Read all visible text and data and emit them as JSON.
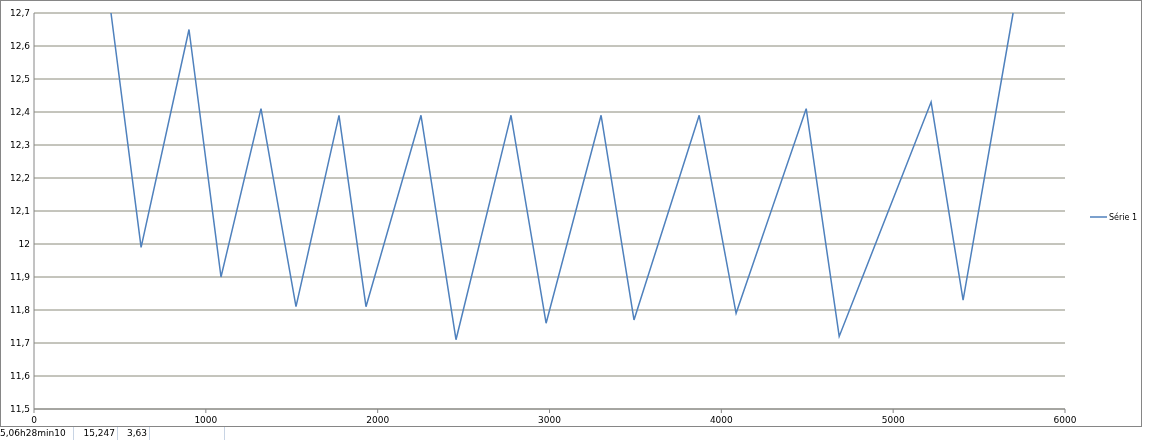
{
  "chart": {
    "chart_data": {
      "type": "line",
      "x": [
        448,
        623,
        902,
        1088,
        1321,
        1525,
        1775,
        1932,
        2252,
        2456,
        2776,
        2980,
        3300,
        3492,
        3871,
        4086,
        4494,
        4686,
        5221,
        5407,
        5698
      ],
      "series": [
        {
          "name": "Série 1",
          "color": "#4f81bd",
          "values": [
            12.7,
            11.99,
            12.65,
            11.9,
            12.41,
            11.81,
            12.39,
            11.81,
            12.39,
            11.71,
            12.39,
            11.76,
            12.39,
            11.77,
            12.39,
            11.79,
            12.41,
            11.72,
            12.43,
            11.83,
            12.7
          ]
        }
      ],
      "grid": true,
      "xlim": [
        0,
        6000
      ],
      "ylim": [
        11.5,
        12.7
      ],
      "xticks": [
        0,
        1000,
        2000,
        3000,
        4000,
        5000,
        6000
      ],
      "yticks": [
        {
          "value": 11.5,
          "label": "11,5"
        },
        {
          "value": 11.6,
          "label": "11,6"
        },
        {
          "value": 11.7,
          "label": "11,7"
        },
        {
          "value": 11.8,
          "label": "11,8"
        },
        {
          "value": 11.9,
          "label": "11,9"
        },
        {
          "value": 12,
          "label": "12"
        },
        {
          "value": 12.1,
          "label": "12,1"
        },
        {
          "value": 12.2,
          "label": "12,2"
        },
        {
          "value": 12.3,
          "label": "12,3"
        },
        {
          "value": 12.4,
          "label": "12,4"
        },
        {
          "value": 12.5,
          "label": "12,5"
        },
        {
          "value": 12.6,
          "label": "12,6"
        },
        {
          "value": 12.7,
          "label": "12,7"
        }
      ]
    }
  },
  "sheet_row": [
    "5,06h28min10",
    "15,247",
    "3,63"
  ]
}
